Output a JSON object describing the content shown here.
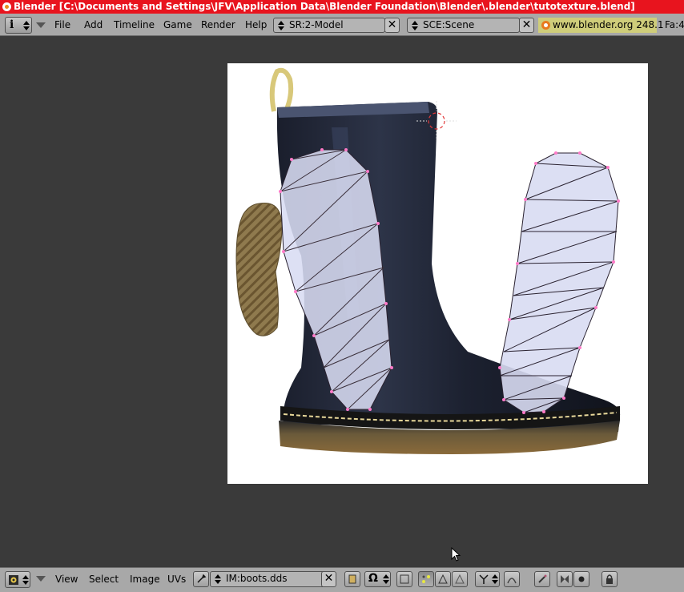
{
  "window": {
    "title": "Blender [C:\\Documents and Settings\\JFV\\Application Data\\Blender Foundation\\Blender\\.blender\\tutotexture.blend]"
  },
  "top_menu": {
    "items": [
      "File",
      "Add",
      "Timeline",
      "Game",
      "Render",
      "Help"
    ],
    "screen_field": "SR:2-Model",
    "scene_field": "SCE:Scene",
    "url": "www.blender.org 248.1",
    "stats": "Fa:4"
  },
  "bottom_menu": {
    "items": [
      "View",
      "Select",
      "Image",
      "UVs"
    ],
    "image_field": "IM:boots.dds"
  },
  "colors": {
    "titlebar": "#e8141e",
    "header": "#a8a8a8",
    "editor_bg": "#3a3a3a",
    "uv_fill": "#d8dcf2",
    "uv_edge": "#2a2230",
    "uv_vertex": "#ff7ac8"
  },
  "icons": [
    "info-icon",
    "image-editor-icon",
    "pin-icon",
    "pack-icon",
    "uv-select-icon",
    "selection-mode-icons",
    "lock-icon"
  ]
}
